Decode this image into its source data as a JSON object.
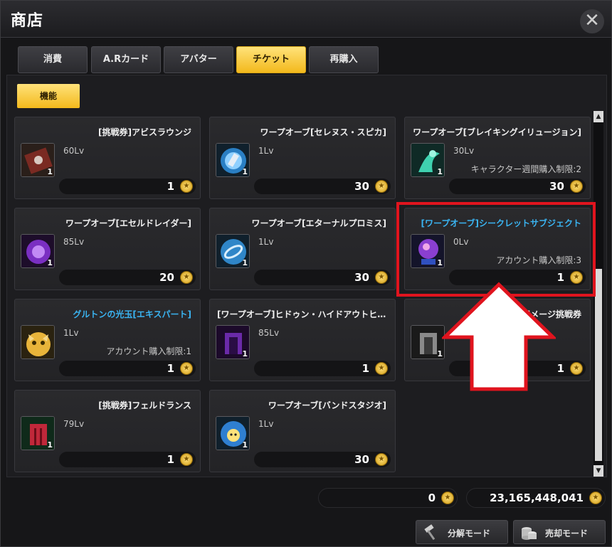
{
  "window": {
    "title": "商店"
  },
  "tabs": [
    {
      "label": "消費",
      "active": false
    },
    {
      "label": "A.Rカード",
      "active": false
    },
    {
      "label": "アバター",
      "active": false
    },
    {
      "label": "チケット",
      "active": true
    },
    {
      "label": "再購入",
      "active": false
    }
  ],
  "subtab": {
    "label": "機能"
  },
  "items": [
    {
      "name": "[挑戦券]アビスラウンジ",
      "level": "60Lv",
      "limit": "",
      "price": "1",
      "qty": "1",
      "name_color": "white",
      "icon": "red-book-icon"
    },
    {
      "name": "ワープオーブ[セレヌス・スピカ]",
      "level": "1Lv",
      "limit": "",
      "price": "30",
      "qty": "1",
      "name_color": "white",
      "icon": "blue-orb-icon"
    },
    {
      "name": "ワープオーブ[ブレイキングイリュージョン]",
      "level": "30Lv",
      "limit": "キャラクター週間購入制限:2",
      "price": "30",
      "qty": "1",
      "name_color": "white",
      "icon": "teal-vortex-icon"
    },
    {
      "name": "ワープオーブ[エセルドレイダー]",
      "level": "85Lv",
      "limit": "",
      "price": "20",
      "qty": "1",
      "name_color": "white",
      "icon": "purple-spirit-icon"
    },
    {
      "name": "ワープオーブ[エターナルプロミス]",
      "level": "1Lv",
      "limit": "",
      "price": "30",
      "qty": "1",
      "name_color": "white",
      "icon": "blue-rings-orb-icon"
    },
    {
      "name": "[ワープオーブ]シークレットサブジェクト",
      "level": "0Lv",
      "limit": "アカウント購入制限:3",
      "price": "1",
      "qty": "1",
      "name_color": "blue",
      "icon": "pink-crystal-ball-icon"
    },
    {
      "name": "グルトンの光玉[エキスパート]",
      "level": "1Lv",
      "limit": "アカウント購入制限:1",
      "price": "1",
      "qty": "",
      "name_color": "blue",
      "icon": "gold-creature-icon"
    },
    {
      "name": "[ワープオーブ]ヒドゥン・ハイドアウトヒー...",
      "level": "85Lv",
      "limit": "",
      "price": "1",
      "qty": "1",
      "name_color": "white",
      "icon": "purple-gate-icon"
    },
    {
      "name": "[ワープオーブ]メージ挑戦券",
      "level": "",
      "limit": "",
      "price": "1",
      "qty": "1",
      "name_color": "white",
      "icon": "gray-gate-icon"
    },
    {
      "name": "[挑戦券]フェルドランス",
      "level": "79Lv",
      "limit": "",
      "price": "1",
      "qty": "1",
      "name_color": "white",
      "icon": "red-gate-icon"
    },
    {
      "name": "ワープオーブ[バンドスタジオ]",
      "level": "1Lv",
      "limit": "",
      "price": "30",
      "qty": "1",
      "name_color": "white",
      "icon": "blue-face-orb-icon"
    }
  ],
  "footer": {
    "currency1": "0",
    "currency2": "23,165,448,041",
    "disassemble_label": "分解モード",
    "sell_label": "売却モード"
  },
  "colors": {
    "accent": "#f3b91c",
    "highlight": "#e0141e",
    "blue_name": "#3ab4f2"
  }
}
